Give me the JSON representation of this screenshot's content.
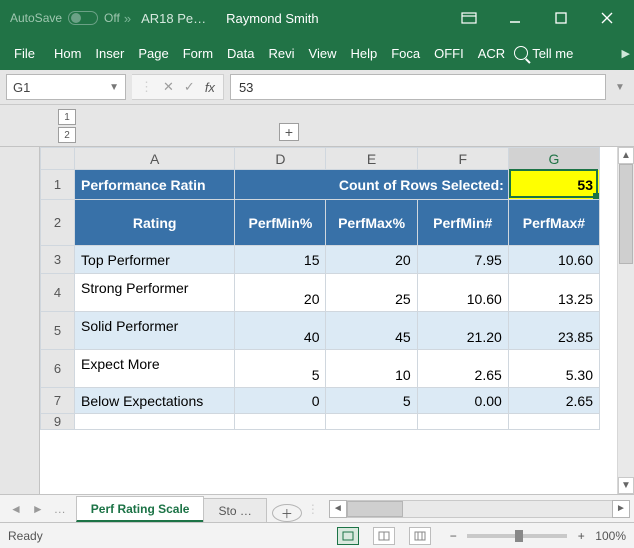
{
  "titlebar": {
    "autosave_label": "AutoSave",
    "autosave_state": "Off",
    "doc_name": "AR18 Pe…",
    "user_name": "Raymond Smith"
  },
  "ribbon": {
    "tabs": [
      "File",
      "Hom",
      "Inser",
      "Page",
      "Form",
      "Data",
      "Revi",
      "View",
      "Help",
      "Foca",
      "OFFI",
      "ACR"
    ],
    "tellme": "Tell me"
  },
  "formula": {
    "name_box": "G1",
    "fx_label": "fx",
    "value": "53"
  },
  "outline": {
    "v1": "1",
    "v2": "2",
    "h1": "1",
    "h2": "2",
    "plus": "+"
  },
  "columns": [
    "A",
    "D",
    "E",
    "F",
    "G"
  ],
  "header_row": {
    "title": "Performance Ratin",
    "count_label": "Count of Rows Selected:",
    "count_value": "53"
  },
  "col_headers": [
    "Rating",
    "PerfMin%",
    "PerfMax%",
    "PerfMin#",
    "PerfMax#"
  ],
  "rows": [
    {
      "n": "3",
      "label": "Top Performer",
      "v": [
        "15",
        "20",
        "7.95",
        "10.60"
      ],
      "alt": true
    },
    {
      "n": "4",
      "label": "Strong Performer",
      "v": [
        "20",
        "25",
        "10.60",
        "13.25"
      ],
      "alt": false
    },
    {
      "n": "5",
      "label": "Solid Performer",
      "v": [
        "40",
        "45",
        "21.20",
        "23.85"
      ],
      "alt": true
    },
    {
      "n": "6",
      "label": "Expect More",
      "v": [
        "5",
        "10",
        "2.65",
        "5.30"
      ],
      "alt": false
    },
    {
      "n": "7",
      "label": "Below Expectations",
      "v": [
        "0",
        "5",
        "0.00",
        "2.65"
      ],
      "alt": true
    }
  ],
  "row1": "1",
  "row2": "2",
  "row9": "9",
  "sheet_tabs": {
    "active": "Perf Rating Scale",
    "next": "Sto …",
    "ellipsis": "…"
  },
  "status": {
    "ready": "Ready",
    "zoom": "100%"
  },
  "chart_data": {
    "type": "table",
    "title": "Performance Rating Scale",
    "count_of_rows_selected": 53,
    "columns": [
      "Rating",
      "PerfMin%",
      "PerfMax%",
      "PerfMin#",
      "PerfMax#"
    ],
    "rows": [
      [
        "Top Performer",
        15,
        20,
        7.95,
        10.6
      ],
      [
        "Strong Performer",
        20,
        25,
        10.6,
        13.25
      ],
      [
        "Solid Performer",
        40,
        45,
        21.2,
        23.85
      ],
      [
        "Expect More",
        5,
        10,
        2.65,
        5.3
      ],
      [
        "Below Expectations",
        0,
        5,
        0.0,
        2.65
      ]
    ]
  }
}
